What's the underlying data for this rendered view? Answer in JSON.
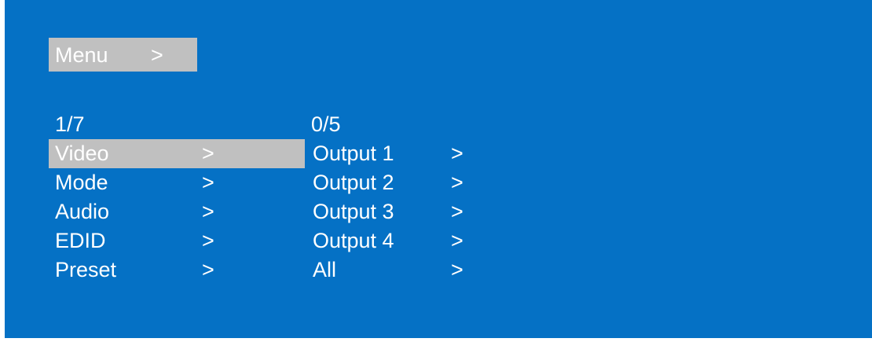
{
  "colors": {
    "background": "#0571c5",
    "highlight": "#c0c0c0",
    "text": "#ffffff"
  },
  "title": {
    "label": "Menu",
    "arrow": ">"
  },
  "left_menu": {
    "counter": "1/7",
    "items": [
      {
        "label": "Video",
        "arrow": ">",
        "selected": true
      },
      {
        "label": "Mode",
        "arrow": ">"
      },
      {
        "label": "Audio",
        "arrow": ">"
      },
      {
        "label": "EDID",
        "arrow": ">"
      },
      {
        "label": "Preset",
        "arrow": ">"
      }
    ]
  },
  "right_menu": {
    "counter": "0/5",
    "items": [
      {
        "label": "Output 1",
        "arrow": ">"
      },
      {
        "label": "Output 2",
        "arrow": ">"
      },
      {
        "label": "Output 3",
        "arrow": ">"
      },
      {
        "label": "Output 4",
        "arrow": ">"
      },
      {
        "label": "All",
        "arrow": ">"
      }
    ]
  }
}
